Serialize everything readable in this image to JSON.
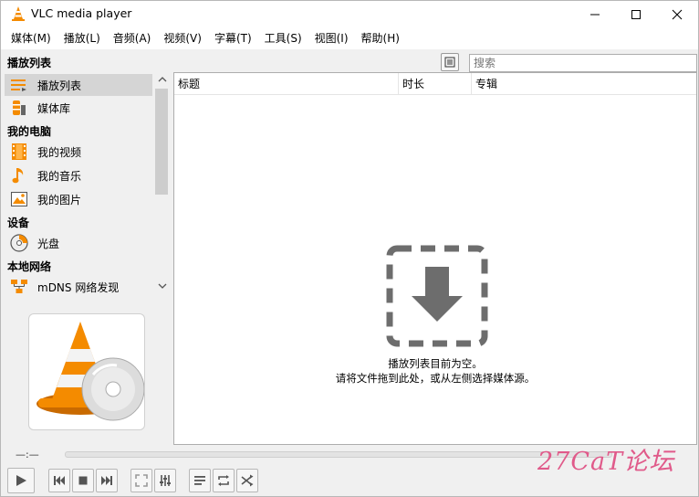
{
  "window": {
    "title": "VLC media player"
  },
  "menu": [
    "媒体(M)",
    "播放(L)",
    "音频(A)",
    "视频(V)",
    "字幕(T)",
    "工具(S)",
    "视图(I)",
    "帮助(H)"
  ],
  "playlist_header": {
    "title": "播放列表",
    "search_placeholder": "搜索"
  },
  "sidebar": {
    "items": [
      {
        "label": "播放列表",
        "icon": "playlist-icon",
        "selected": true
      },
      {
        "label": "媒体库",
        "icon": "media-library-icon"
      }
    ],
    "categories": [
      {
        "label": "我的电脑",
        "items": [
          {
            "label": "我的视频",
            "icon": "film-icon"
          },
          {
            "label": "我的音乐",
            "icon": "music-note-icon"
          },
          {
            "label": "我的图片",
            "icon": "picture-icon"
          }
        ]
      },
      {
        "label": "设备",
        "items": [
          {
            "label": "光盘",
            "icon": "disc-icon"
          }
        ]
      },
      {
        "label": "本地网络",
        "items": [
          {
            "label": "mDNS 网络发现",
            "icon": "network-icon"
          }
        ]
      }
    ]
  },
  "playlist": {
    "columns": [
      "标题",
      "时长",
      "专辑"
    ],
    "empty_message_line1": "播放列表目前为空。",
    "empty_message_line2": "请将文件拖到此处，或从左侧选择媒体源。"
  },
  "player": {
    "time": "—:—"
  },
  "watermark": "27CaT论坛",
  "colors": {
    "accent_orange": "#f48b00",
    "icon_gray": "#6d6d6d",
    "watermark": "#e05a8a"
  }
}
